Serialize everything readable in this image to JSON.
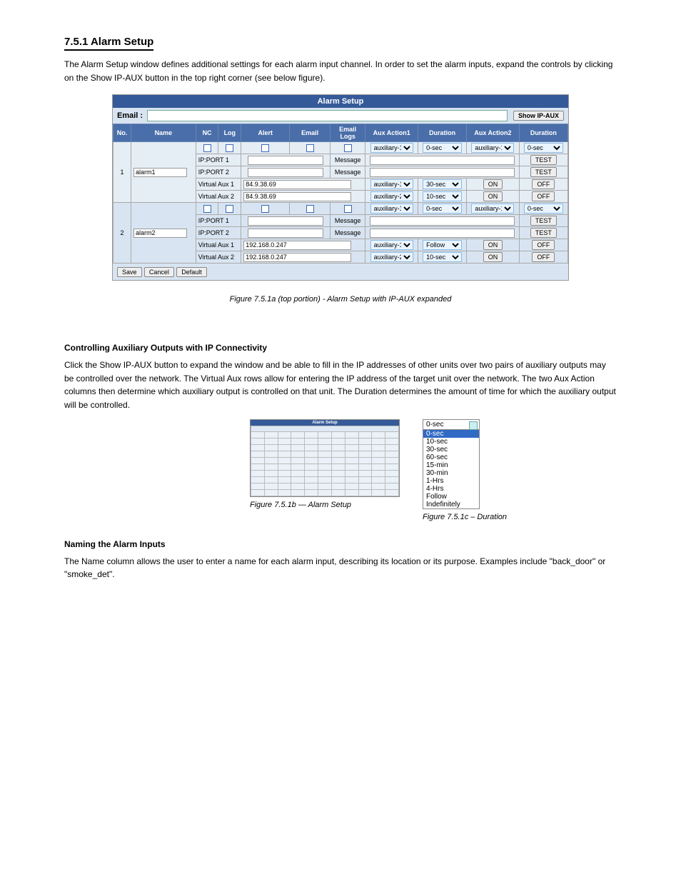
{
  "headings": {
    "h2": "7.5.1 Alarm Setup",
    "h3a": "Controlling Auxiliary Outputs with IP Connectivity",
    "h3b": "Naming the Alarm Inputs"
  },
  "para": {
    "intro": "The Alarm Setup window defines additional settings for each alarm input channel. In order to set the alarm inputs, expand the controls by clicking on the Show IP-AUX button in the top right corner (see below figure).",
    "fig751": "Figure 7.5.1a (top portion) - Alarm Setup with IP-AUX expanded",
    "aux_intro": "Click the Show IP-AUX button to expand the window and be able to fill in the IP addresses of other units over two pairs of auxiliary outputs may be controlled over the network. The Virtual Aux rows allow for entering the IP address of the target unit over the network. The two Aux Action columns then determine which auxiliary output is controlled on that unit. The Duration determines the amount of time for which the auxiliary output will be controlled.",
    "fig751b": "Figure 7.5.1b — Alarm Setup",
    "fig751c": "Figure 7.5.1c – Duration",
    "naming": "The Name column allows the user to enter a name for each alarm input, describing its location or its purpose. Examples include \"back_door\" or \"smoke_det\"."
  },
  "screenshot": {
    "title": "Alarm Setup",
    "email_label": "Email :",
    "show_ipaux": "Show IP-AUX",
    "cols": {
      "no": "No.",
      "name": "Name",
      "nc": "NC",
      "log": "Log",
      "alert": "Alert",
      "email": "Email",
      "elogs": "Email Logs",
      "aa1": "Aux Action1",
      "dur": "Duration",
      "aa2": "Aux Action2",
      "dur2": "Duration"
    },
    "row1": {
      "no": "1",
      "name": "alarm1",
      "ipport1": "IP:PORT 1",
      "ipport2": "IP:PORT 2",
      "vaux1": "Virtual Aux 1",
      "vaux2": "Virtual Aux 2",
      "ip": "84.9.38.69",
      "msg": "Message",
      "aux_sel_a": "auxiliary-1",
      "dura": "0-sec",
      "aux_sel_b": "auxiliary-1",
      "durb": "0-sec",
      "aux_on": "ON",
      "aux_off": "OFF",
      "aux_row_a": "auxiliary-1",
      "aux_row_a_dur": "30-sec",
      "aux_row_b": "auxiliary-2",
      "aux_row_b_dur": "10-sec",
      "test": "TEST"
    },
    "row2": {
      "no": "2",
      "name": "alarm2",
      "ip": "192.168.0.247",
      "aux_row_a": "auxiliary-1",
      "aux_row_a_dur": "Follow",
      "aux_row_b": "auxiliary-2",
      "aux_row_b_dur": "10-sec"
    },
    "buttons": {
      "save": "Save",
      "cancel": "Cancel",
      "default": "Default"
    }
  },
  "duration_list": {
    "top": "0-sec",
    "items": [
      "0-sec",
      "10-sec",
      "30-sec",
      "60-sec",
      "15-min",
      "30-min",
      "1-Hrs",
      "4-Hrs",
      "Follow",
      "Indefinitely"
    ]
  }
}
